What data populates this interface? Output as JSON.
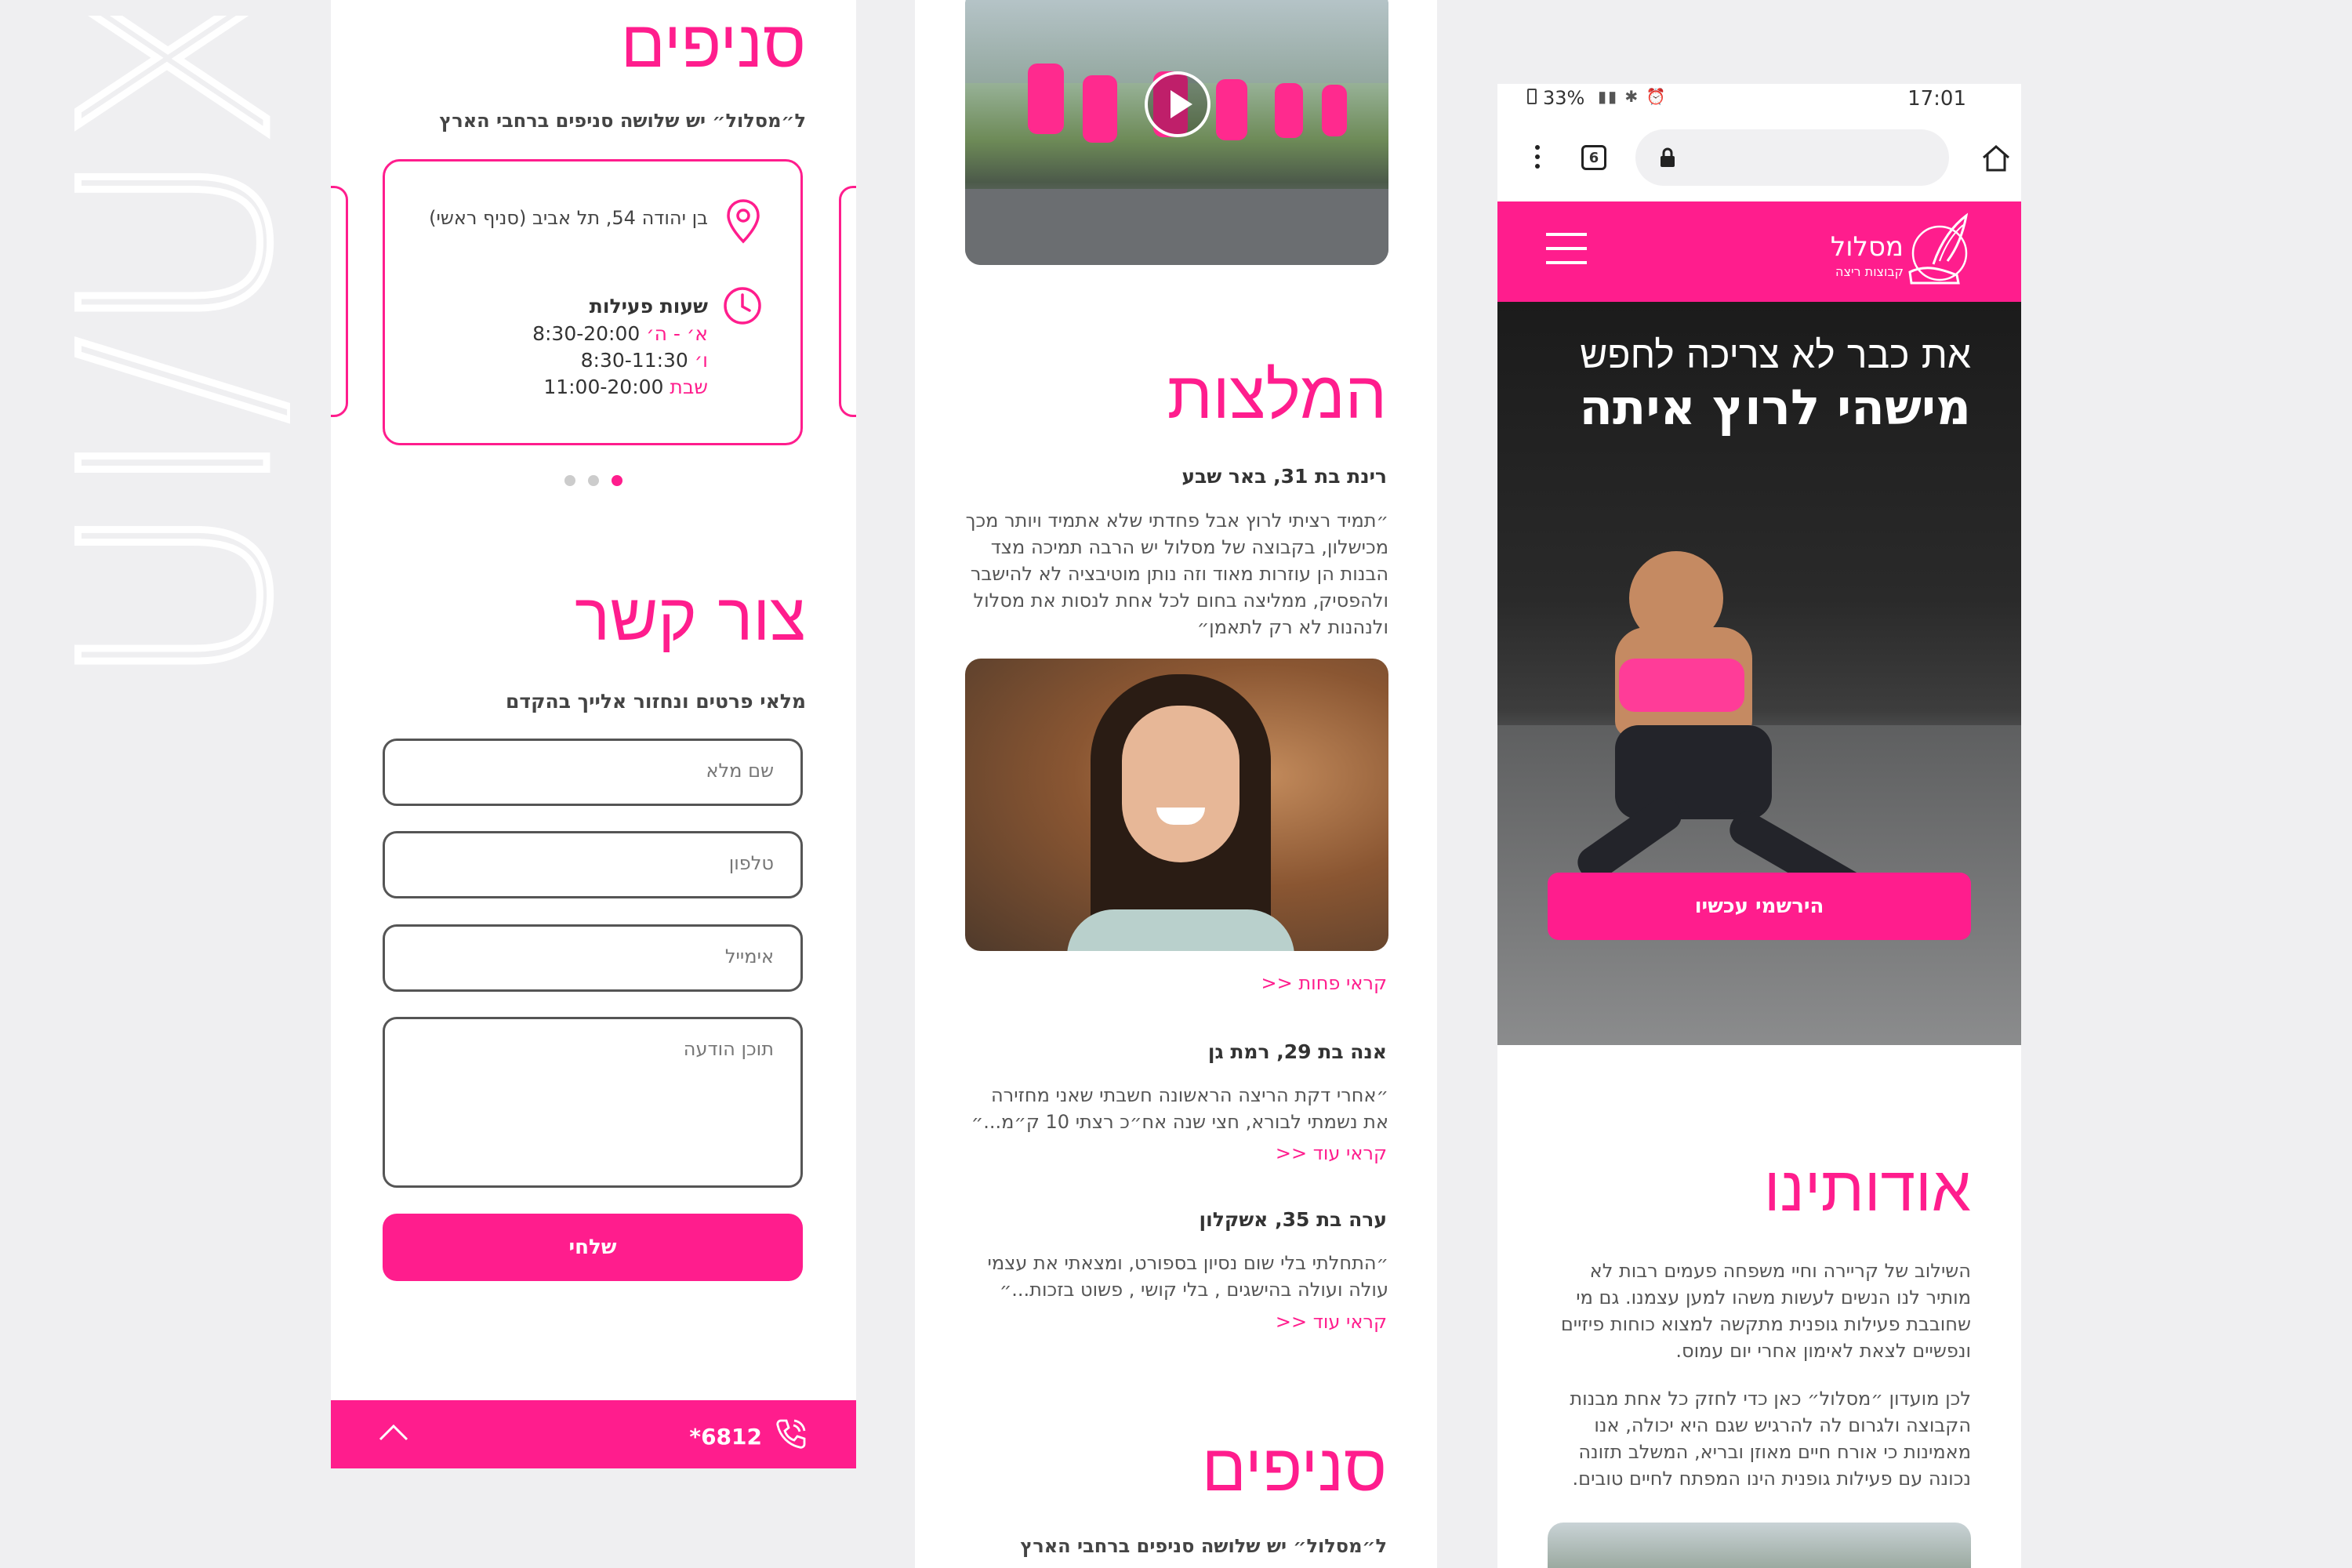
{
  "brand_word": "UI/UX",
  "colors": {
    "accent": "#ff1d8d",
    "bg": "#efeff1"
  },
  "panel1": {
    "branches_title": "סניפים",
    "branches_subtitle": "ל״מסלול״ יש שלושה סניפים ברחבי הארץ",
    "branch": {
      "address": "בן יהודה 54, תל אביב (סניף ראשי)",
      "hours_title": "שעות פעילות",
      "hours": [
        {
          "day": "א׳ - ה׳",
          "time": "8:30-20:00"
        },
        {
          "day": "ו׳",
          "time": "8:30-11:30"
        },
        {
          "day": "שבת",
          "time": "11:00-20:00"
        }
      ]
    },
    "contact_title": "צור קשר",
    "contact_subtitle": "מלאי פרטים ונחזור אלייך בהקדם",
    "fields": {
      "name": "שם מלא",
      "phone": "טלפון",
      "email": "אימייל",
      "message": "תוכן הודעה"
    },
    "send_label": "שלחי",
    "footer_phone": "*6812"
  },
  "panel2": {
    "recommendations_title": "המלצות",
    "testimonials": [
      {
        "name": "רינת בת 31, באר שבע",
        "quote": "״תמיד רציתי לרוץ אבל פחדתי שלא אתמיד ויותר מכך מכישלון, בקבוצה של מסלול יש הרבה תמיכה מצד הבנות הן עוזרות מאוד וזה נותן מוטיבציה לא להישבר ולהפסיק, ממליצה בחום לכל אחת לנסות את מסלול ולנהנות לא רק לתאמן״",
        "link": "קראי פחות <<"
      },
      {
        "name": "אנה בת 29, רמת גן",
        "quote": "״אחרי דקת הריצה הראשונה חשבתי שאני מחזירה את נשמתי לבורא, חצי שנה אח״כ רצתי 10 ק״מ...״",
        "link": "קראי עוד <<"
      },
      {
        "name": "ערה בת 35, אשקלון",
        "quote": "״התחלתי בלי שום נסיון בספורט, ומצאתי את עצמי עולה ועולה בהישגים , בלי קושי , פשוט בזכות...״",
        "link": "קראי עוד <<"
      }
    ],
    "branches_title": "סניפים",
    "branches_subtitle": "ל״מסלול״ יש שלושה סניפים ברחבי הארץ"
  },
  "panel3": {
    "status": {
      "battery": "33%",
      "time": "17:01"
    },
    "tabs_count": "6",
    "logo_name": "מסלול",
    "logo_sub": "קבוצות ריצה",
    "hero_line1": "את כבר לא צריכה לחפש",
    "hero_line2": "מישהי לרוץ איתה",
    "cta_label": "הירשמי עכשיו",
    "about_title": "אודותינו",
    "about_p1": "השילוב של קריירה וחיי משפחה פעמים רבות לא מותיר לנו הנשים לעשות משהו למען עצמנו.  גם מי שחובבת פעילות גופנית מתקשה למצוא כוחות פיזיים ונפשיים לצאת לאימון אחרי יום עמוס.",
    "about_p2": "לכן מועדון ״מסלול״ כאן כדי לחזק כל אחת מבנות הקבוצה ולגרום לה להרגיש שגם היא יכולה, אנו מאמינות כי אורח חיים מאוזן ובריא, המשלב תזונה נכונה עם פעילות גופנית הינו המפתח לחיים טובים."
  }
}
